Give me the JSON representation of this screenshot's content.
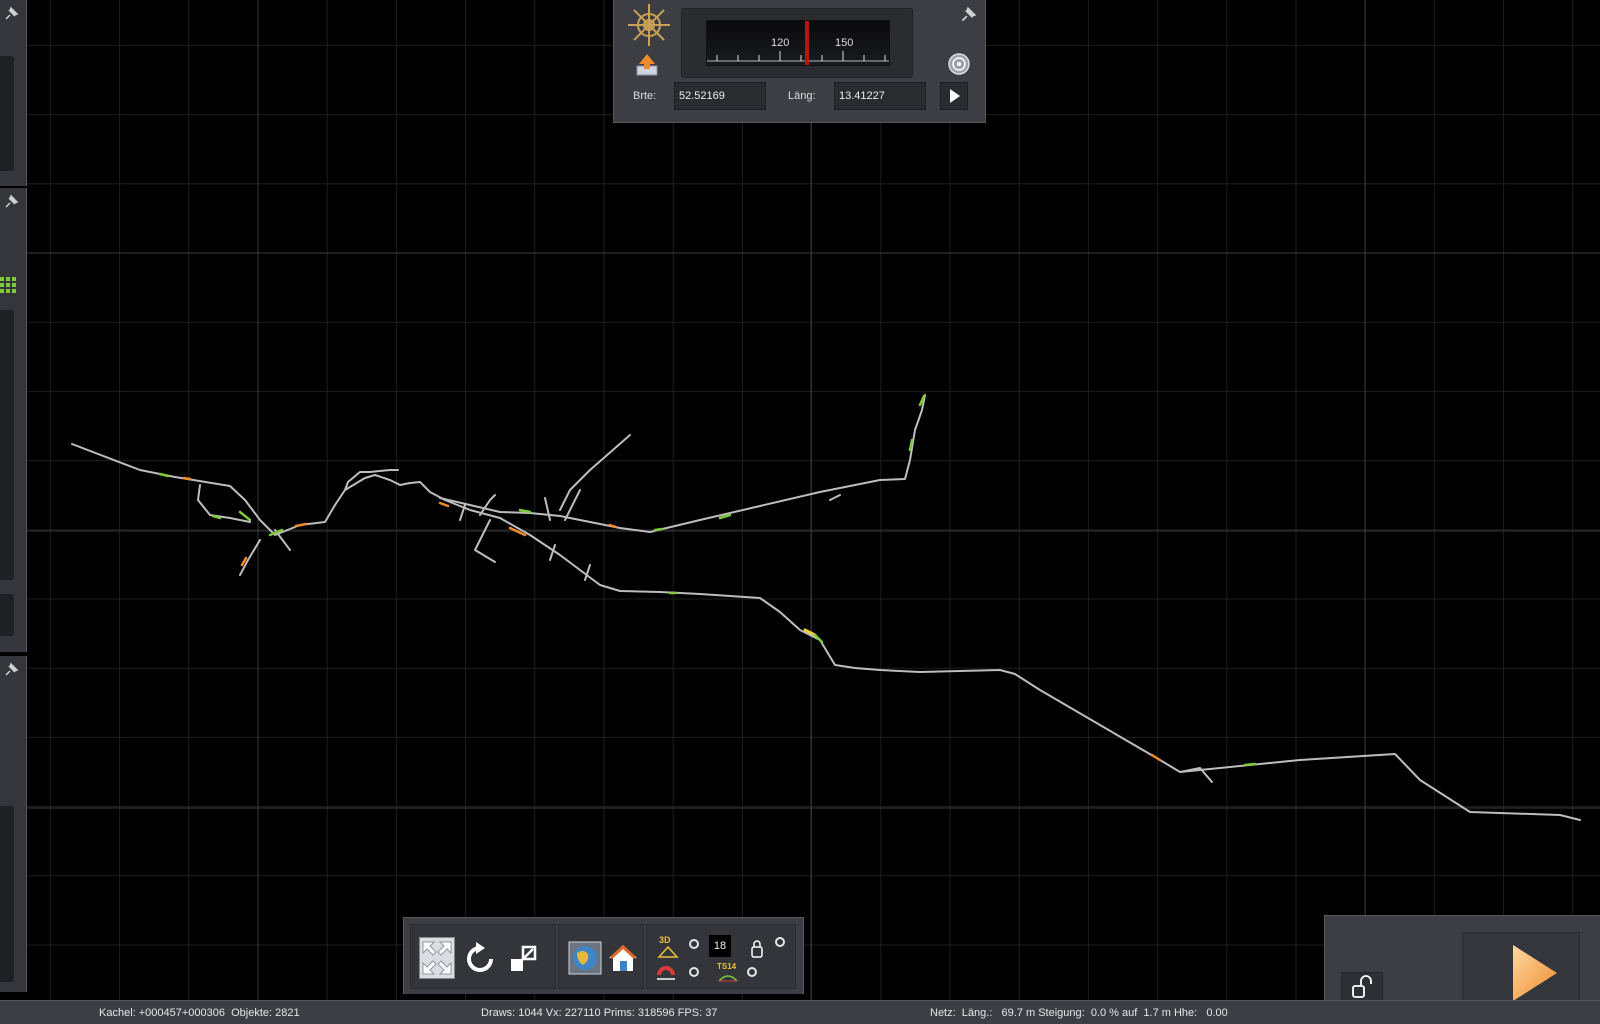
{
  "compass": {
    "gauge_ticks": [
      "120",
      "150"
    ],
    "latitude_label": "Brte:",
    "latitude_value": "52.52169",
    "longitude_label": "Läng:",
    "longitude_value": "13.41227"
  },
  "toolbar": {
    "zoom_level": "18",
    "label_3d": "3D",
    "ts_label": "TS14"
  },
  "status": {
    "tile": "Kachel: +000457+000306  Objekte: 2821",
    "render": "Draws: 1044 Vx: 227110 Prims: 318596 FPS: 37",
    "track": "Netz:  Läng.:   69.7 m Steigung:  0.0 % auf  1.7 m Hhe:   0.00"
  },
  "colors": {
    "background": "#000000",
    "panel": "#3c3e44",
    "track": "#bdbdbd",
    "track_green": "#7ecb3a",
    "track_orange": "#f08a2c",
    "play_accent": "#f3a64a"
  }
}
